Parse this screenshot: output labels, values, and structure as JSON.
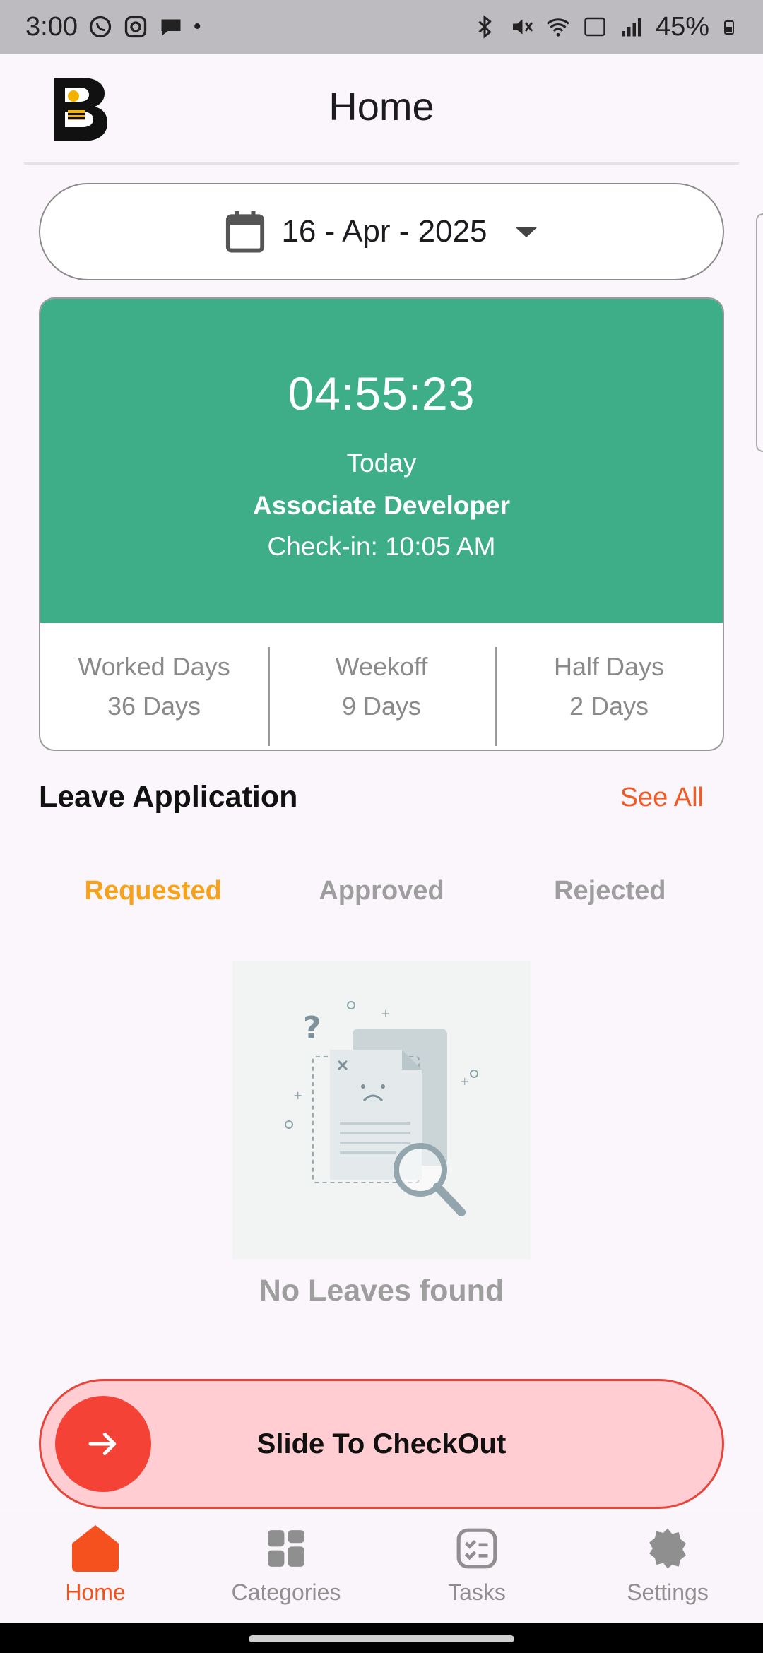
{
  "status_bar": {
    "time": "3:00",
    "dot": "•",
    "battery": "45%",
    "left_icons": [
      "whatsapp-icon",
      "instagram-icon",
      "message-icon"
    ],
    "right_icons": [
      "bluetooth-icon",
      "mute-icon",
      "wifi-icon",
      "vowifi-icon",
      "signal-icon",
      "battery-icon"
    ]
  },
  "header": {
    "title": "Home",
    "logo_letter": "B"
  },
  "date_picker": {
    "value": "16 - Apr - 2025",
    "icon": "calendar-icon"
  },
  "attendance": {
    "timer": "04:55:23",
    "day": "Today",
    "role": "Associate Developer",
    "checkin": "Check-in: 10:05 AM",
    "stats": [
      {
        "label": "Worked Days",
        "value": "36 Days"
      },
      {
        "label": "Weekoff",
        "value": "9 Days"
      },
      {
        "label": "Half Days",
        "value": "2 Days"
      }
    ]
  },
  "leave": {
    "title": "Leave Application",
    "see_all": "See All",
    "tabs": [
      {
        "label": "Requested",
        "active": true
      },
      {
        "label": "Approved",
        "active": false
      },
      {
        "label": "Rejected",
        "active": false
      }
    ],
    "empty_text": "No Leaves found"
  },
  "slider": {
    "label": "Slide To CheckOut",
    "icon": "arrow-right-icon"
  },
  "bottom_nav": [
    {
      "label": "Home",
      "icon": "home-icon",
      "active": true
    },
    {
      "label": "Categories",
      "icon": "categories-icon",
      "active": false
    },
    {
      "label": "Tasks",
      "icon": "tasks-icon",
      "active": false
    },
    {
      "label": "Settings",
      "icon": "settings-icon",
      "active": false
    }
  ],
  "colors": {
    "primary_green": "#3dae88",
    "accent_orange": "#f15a24",
    "active_tab": "#f7a21b",
    "slider_red": "#f44336",
    "slider_bg": "#ffcdd2"
  }
}
